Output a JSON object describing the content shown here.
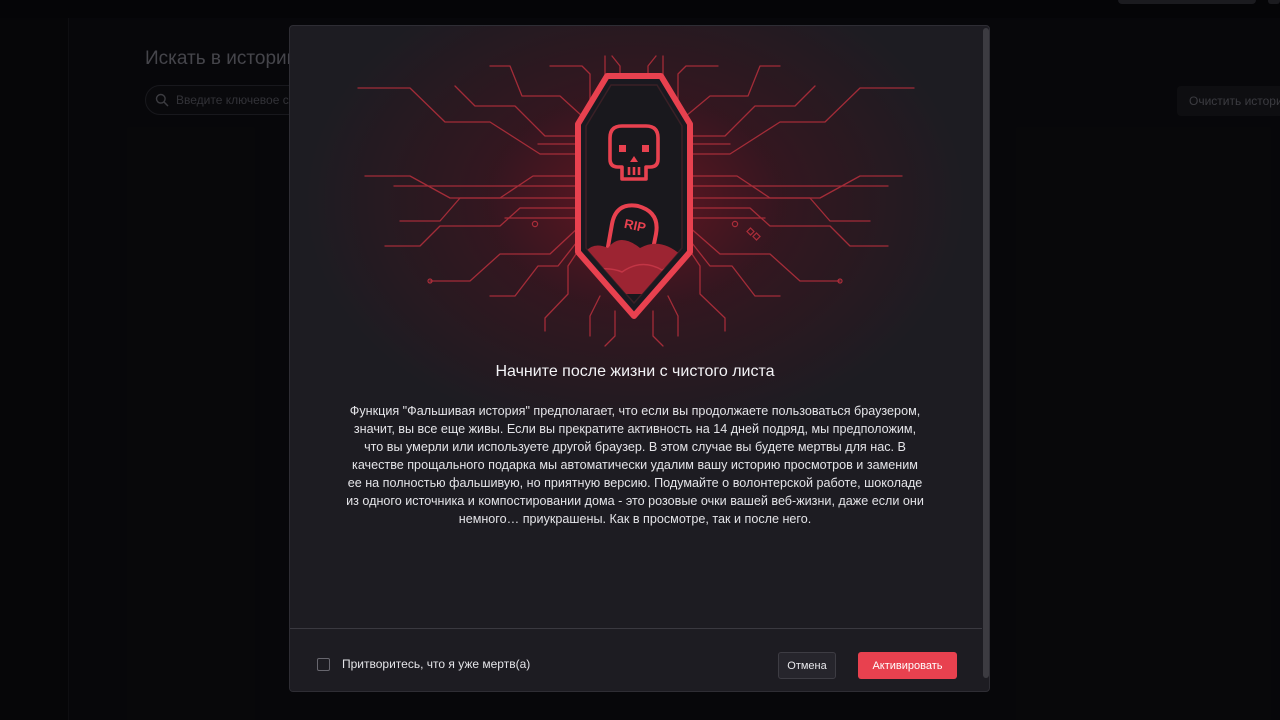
{
  "background": {
    "heading": "Искать в истории",
    "search_placeholder": "Введите ключевое слово",
    "clear_button": "Очистить историю"
  },
  "modal": {
    "badge_text": "RIP",
    "title": "Начните после жизни с чистого листа",
    "body": "Функция \"Фальшивая история\" предполагает, что если вы продолжаете пользоваться браузером, значит, вы все еще живы. Если вы прекратите активность на 14 дней подряд, мы предположим, что вы умерли или используете другой браузер. В этом случае вы будете мертвы для нас. В качестве прощального подарка мы автоматически удалим вашу историю просмотров и заменим ее на полностью фальшивую, но приятную версию. Подумайте о волонтерской работе, шоколаде из одного источника и компостировании дома - это розовые очки вашей веб-жизни, даже если они немного… приукрашены. Как в просмотре, так и после него.",
    "checkbox_label": "Притворитесь, что я уже мертв(а)",
    "checkbox_checked": false,
    "cancel_button": "Отмена",
    "activate_button": "Активировать"
  },
  "colors": {
    "accent": "#e8414f",
    "page_background": "#0c0c10",
    "modal_background": "#1d1c22",
    "badge_fill": "#19181d",
    "circuit": "#b8303d"
  },
  "icons": {
    "search": "search-icon",
    "skull": "skull-icon",
    "tombstone": "tombstone-icon"
  }
}
